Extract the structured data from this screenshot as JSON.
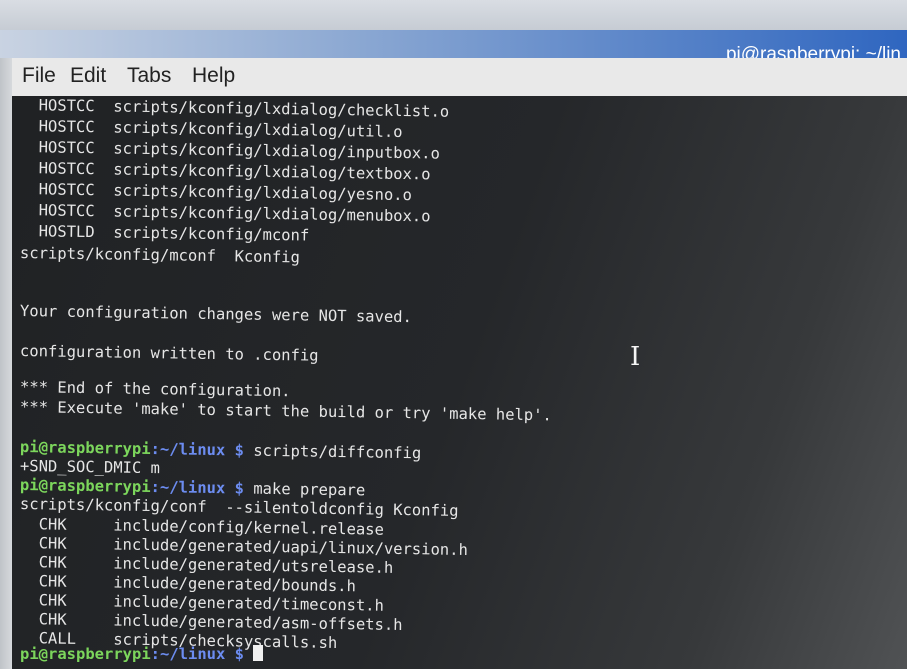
{
  "window": {
    "title": "pi@raspberrypi: ~/lin"
  },
  "menu": [
    "File",
    "Edit",
    "Tabs",
    "Help"
  ],
  "terminal": {
    "lines": [
      "  HOSTCC  scripts/kconfig/lxdialog/checklist.o",
      "  HOSTCC  scripts/kconfig/lxdialog/util.o",
      "  HOSTCC  scripts/kconfig/lxdialog/inputbox.o",
      "  HOSTCC  scripts/kconfig/lxdialog/textbox.o",
      "  HOSTCC  scripts/kconfig/lxdialog/yesno.o",
      "  HOSTCC  scripts/kconfig/lxdialog/menubox.o",
      "  HOSTLD  scripts/kconfig/mconf",
      "scripts/kconfig/mconf  Kconfig",
      "",
      "",
      "Your configuration changes were NOT saved.",
      "",
      "configuration written to .config",
      "",
      "*** End of the configuration.",
      "*** Execute 'make' to start the build or try 'make help'.",
      "",
      "+SND_SOC_DMIC m",
      "scripts/kconfig/conf  --silentoldconfig Kconfig",
      "  CHK     include/config/kernel.release",
      "  CHK     include/generated/uapi/linux/version.h",
      "  CHK     include/generated/utsrelease.h",
      "  CHK     include/generated/bounds.h",
      "  CHK     include/generated/timeconst.h",
      "  CHK     include/generated/asm-offsets.h",
      "  CALL    scripts/checksyscalls.sh"
    ],
    "prompt_user": "pi@raspberrypi",
    "prompt_path": ":~/linux $",
    "commands": [
      "scripts/diffconfig",
      "make prepare",
      ""
    ]
  }
}
